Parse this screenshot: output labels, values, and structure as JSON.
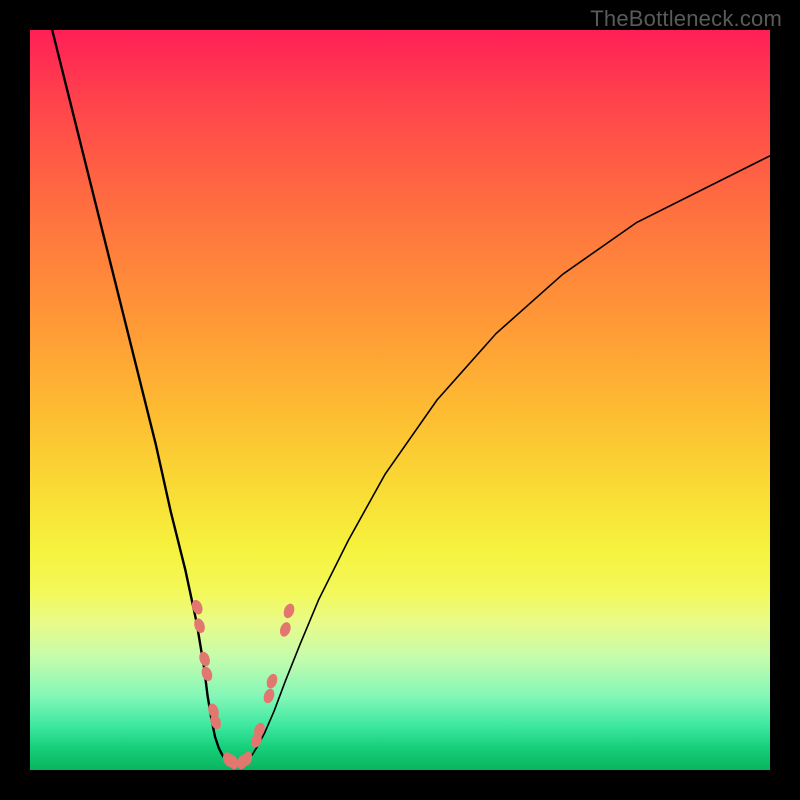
{
  "watermark": "TheBottleneck.com",
  "colors": {
    "nodule_fill": "#e2776f",
    "curve_stroke": "#000000"
  },
  "chart_data": {
    "type": "line",
    "title": "",
    "xlabel": "",
    "ylabel": "",
    "xlim": [
      0,
      100
    ],
    "ylim": [
      0,
      100
    ],
    "series": [
      {
        "name": "left-branch",
        "x": [
          3,
          5,
          8,
          11,
          14,
          17,
          19,
          21,
          22.5,
          23.5,
          24,
          24.5,
          25,
          25.5,
          26,
          26.5,
          27
        ],
        "y": [
          100,
          92,
          80,
          68,
          56,
          44,
          35,
          27,
          20,
          14,
          10,
          7,
          4.5,
          3,
          2,
          1.3,
          1
        ]
      },
      {
        "name": "right-branch",
        "x": [
          29,
          29.5,
          30,
          30.8,
          31.7,
          33,
          34.5,
          36.5,
          39,
          43,
          48,
          55,
          63,
          72,
          82,
          92,
          100
        ],
        "y": [
          1,
          1.3,
          2,
          3.3,
          5,
          8,
          12,
          17,
          23,
          31,
          40,
          50,
          59,
          67,
          74,
          79,
          83
        ]
      }
    ],
    "flat_segment": {
      "x": [
        27,
        29
      ],
      "y": [
        1,
        1
      ]
    },
    "nodules_left": [
      {
        "x": 22.6,
        "y": 22
      },
      {
        "x": 22.9,
        "y": 19.5
      },
      {
        "x": 23.6,
        "y": 15
      },
      {
        "x": 23.9,
        "y": 13
      },
      {
        "x": 24.8,
        "y": 8
      },
      {
        "x": 25.1,
        "y": 6.5
      },
      {
        "x": 26.8,
        "y": 1.4
      },
      {
        "x": 27.4,
        "y": 1.1
      }
    ],
    "nodules_right": [
      {
        "x": 28.7,
        "y": 1.1
      },
      {
        "x": 29.3,
        "y": 1.5
      },
      {
        "x": 30.6,
        "y": 4
      },
      {
        "x": 31.0,
        "y": 5.4
      },
      {
        "x": 32.3,
        "y": 10
      },
      {
        "x": 32.7,
        "y": 12
      },
      {
        "x": 34.5,
        "y": 19
      },
      {
        "x": 35.0,
        "y": 21.5
      }
    ]
  }
}
